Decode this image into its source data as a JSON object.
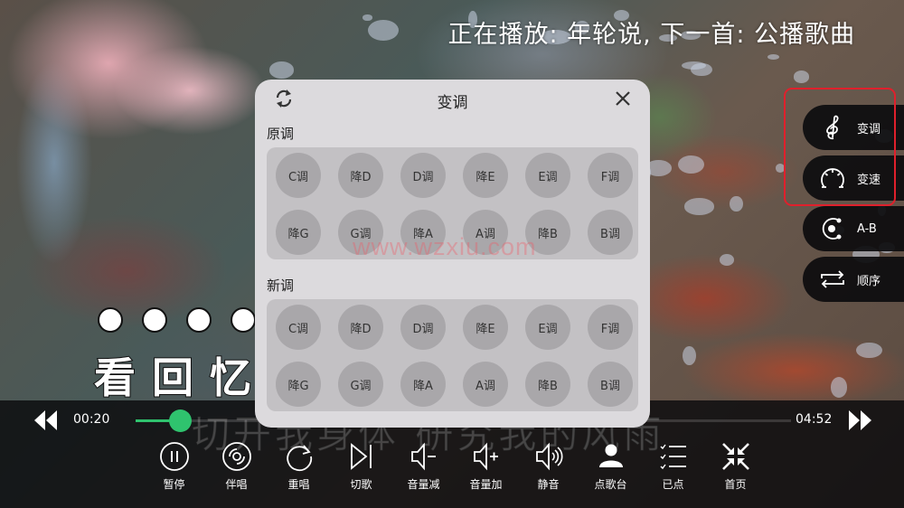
{
  "header": {
    "now_playing": "正在播放: 年轮说, 下一首: 公播歌曲"
  },
  "lyrics": {
    "countdown_dots": 4,
    "current_line": "看回忆",
    "next_line": "切开我身体 研究我的风雨"
  },
  "player": {
    "elapsed": "00:20",
    "duration": "04:52",
    "progress_fraction": 0.068,
    "accent_color": "#2fc36e",
    "rewind_icon": "rewind-icon",
    "forward_icon": "fast-forward-icon"
  },
  "controls": [
    {
      "label": "暂停",
      "icon": "pause-icon"
    },
    {
      "label": "伴唱",
      "icon": "accompaniment-icon"
    },
    {
      "label": "重唱",
      "icon": "replay-icon"
    },
    {
      "label": "切歌",
      "icon": "skip-next-icon"
    },
    {
      "label": "音量减",
      "icon": "volume-down-icon"
    },
    {
      "label": "音量加",
      "icon": "volume-up-icon"
    },
    {
      "label": "静音",
      "icon": "mute-icon"
    },
    {
      "label": "点歌台",
      "icon": "user-icon"
    },
    {
      "label": "已点",
      "icon": "checklist-icon"
    },
    {
      "label": "首页",
      "icon": "collapse-icon"
    }
  ],
  "side_menu": [
    {
      "label": "变调",
      "icon": "treble-clef-icon"
    },
    {
      "label": "变速",
      "icon": "speedometer-icon"
    },
    {
      "label": "A-B",
      "icon": "ab-loop-icon"
    },
    {
      "label": "顺序",
      "icon": "repeat-icon"
    }
  ],
  "highlight_color": "#e0202c",
  "key_dialog": {
    "title": "变调",
    "refresh_icon": "refresh-icon",
    "close_icon": "close-icon",
    "original_label": "原调",
    "new_label": "新调",
    "original_keys": [
      "C调",
      "降D",
      "D调",
      "降E",
      "E调",
      "F调",
      "降G",
      "G调",
      "降A",
      "A调",
      "降B",
      "B调"
    ],
    "new_keys": [
      "C调",
      "降D",
      "D调",
      "降E",
      "E调",
      "F调",
      "降G",
      "G调",
      "降A",
      "A调",
      "降B",
      "B调"
    ]
  },
  "watermark": "www.wzxiu.com"
}
